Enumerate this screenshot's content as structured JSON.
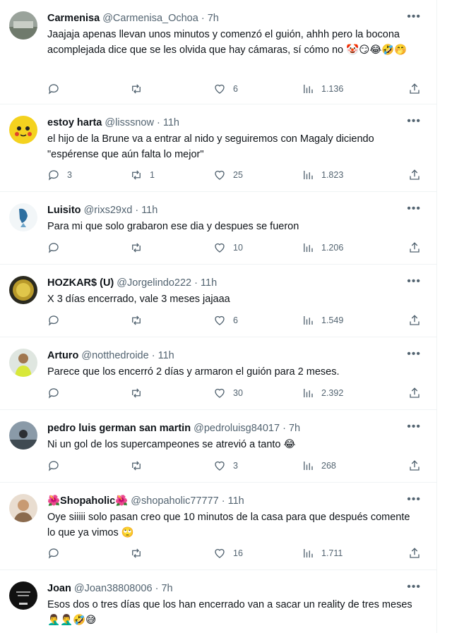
{
  "tweets": [
    {
      "name": "Carmenisa",
      "handle": "@Carmenisa_Ochoa",
      "time": "7h",
      "text": "Jaajaja apenas llevan unos minutos y comenzó el guión, ahhh pero la bocona acomplejada dice que se les olvida que hay cámaras, sí cómo no 🤡😏😂🤣🤭",
      "replies": "",
      "retweets": "",
      "likes": "6",
      "views": "1.136"
    },
    {
      "name": "estoy harta",
      "handle": "@lisssnow",
      "time": "11h",
      "text": "el hijo de la Brune va a entrar al nido y seguiremos con Magaly diciendo \"espérense que aún falta lo mejor\"",
      "replies": "3",
      "retweets": "1",
      "likes": "25",
      "views": "1.823"
    },
    {
      "name": "Luisito",
      "handle": "@rixs29xd",
      "time": "11h",
      "text": "Para mi que solo grabaron ese dia y despues se fueron",
      "replies": "",
      "retweets": "",
      "likes": "10",
      "views": "1.206"
    },
    {
      "name": "HOZKAR$ (U)",
      "handle": "@Jorgelindo222",
      "time": "11h",
      "text": "X 3 días encerrado, vale 3 meses jajaaa",
      "replies": "",
      "retweets": "",
      "likes": "6",
      "views": "1.549"
    },
    {
      "name": "Arturo",
      "handle": "@notthedroide",
      "time": "11h",
      "text": "Parece que los encerró 2 días y armaron el guión para 2 meses.",
      "replies": "",
      "retweets": "",
      "likes": "30",
      "views": "2.392"
    },
    {
      "name": "pedro luis german san martin",
      "handle": "@pedroluisg84017",
      "time": "7h",
      "text": "Ni un gol de los supercampeones se atrevió a tanto 😂",
      "replies": "",
      "retweets": "",
      "likes": "3",
      "views": "268"
    },
    {
      "name": "🌺Shopaholic🌺",
      "handle": "@shopaholic77777",
      "time": "11h",
      "text": "Oye siiiii solo pasan creo que 10 minutos de la casa para que después comente lo que ya vimos 🙄",
      "replies": "",
      "retweets": "",
      "likes": "16",
      "views": "1.711"
    },
    {
      "name": "Joan",
      "handle": "@Joan38808006",
      "time": "7h",
      "text": "Esos dos o tres días que los han encerrado van a sacar un reality de tres meses 🤦‍♂️🤦‍♂️🤣😅",
      "replies": "",
      "retweets": "",
      "likes": "",
      "views": ""
    }
  ],
  "separator": "·",
  "more_label": "•••"
}
